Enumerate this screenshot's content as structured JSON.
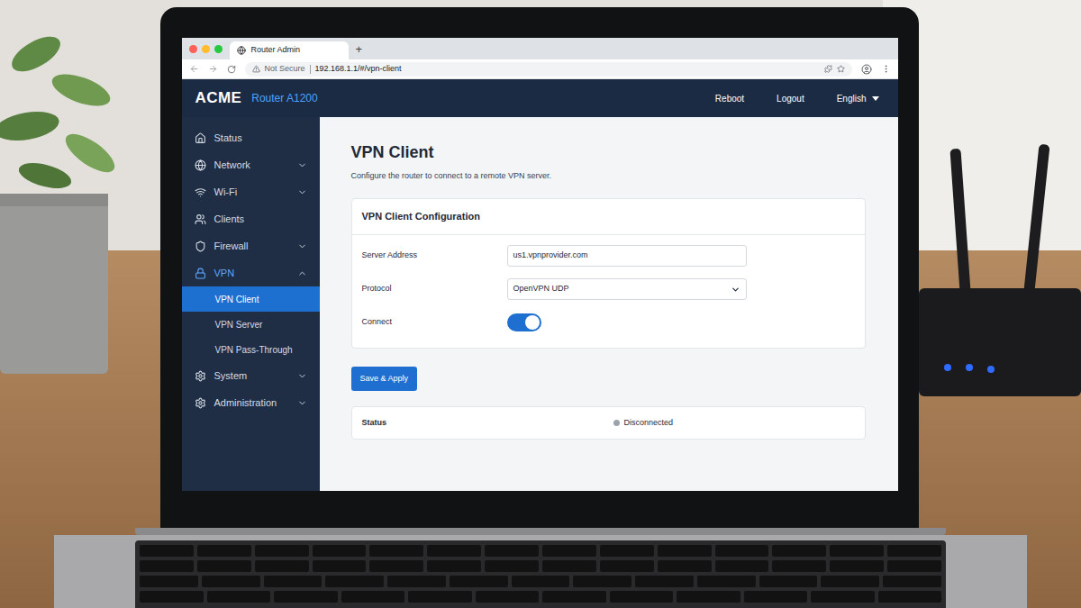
{
  "browser": {
    "tab_title": "Router Admin",
    "new_tab": "+",
    "security": "Not Secure",
    "url": "192.168.1.1/#/vpn-client"
  },
  "header": {
    "brand": "ACME",
    "model": "Router A1200",
    "actions": [
      "Reboot",
      "Logout"
    ],
    "language": "English"
  },
  "sidebar": {
    "items": [
      {
        "label": "Status",
        "expandable": false,
        "expanded": false,
        "children": []
      },
      {
        "label": "Network",
        "expandable": true,
        "expanded": false,
        "children": []
      },
      {
        "label": "Wi-Fi",
        "expandable": true,
        "expanded": false,
        "children": []
      },
      {
        "label": "Clients",
        "expandable": false,
        "expanded": false,
        "children": []
      },
      {
        "label": "Firewall",
        "expandable": true,
        "expanded": false,
        "children": []
      },
      {
        "label": "VPN",
        "expandable": true,
        "expanded": true,
        "children": [
          {
            "label": "VPN Client",
            "selected": true
          },
          {
            "label": "VPN Server",
            "selected": false
          },
          {
            "label": "VPN Pass-Through",
            "selected": false
          }
        ]
      },
      {
        "label": "System",
        "expandable": true,
        "expanded": false,
        "children": []
      },
      {
        "label": "Administration",
        "expandable": true,
        "expanded": false,
        "children": []
      }
    ]
  },
  "page": {
    "title": "VPN Client",
    "description": "Configure the router to connect to a remote VPN server.",
    "config": {
      "title": "VPN Client Configuration",
      "fields": [
        {
          "label": "Server Address",
          "kind": "text",
          "value": "us1.vpnprovider.com"
        },
        {
          "label": "Protocol",
          "kind": "select",
          "value": "OpenVPN UDP"
        },
        {
          "label": "Connect",
          "kind": "toggle",
          "on": true
        }
      ]
    },
    "save_button": "Save & Apply",
    "status": {
      "label": "Status",
      "value": "Disconnected"
    }
  }
}
